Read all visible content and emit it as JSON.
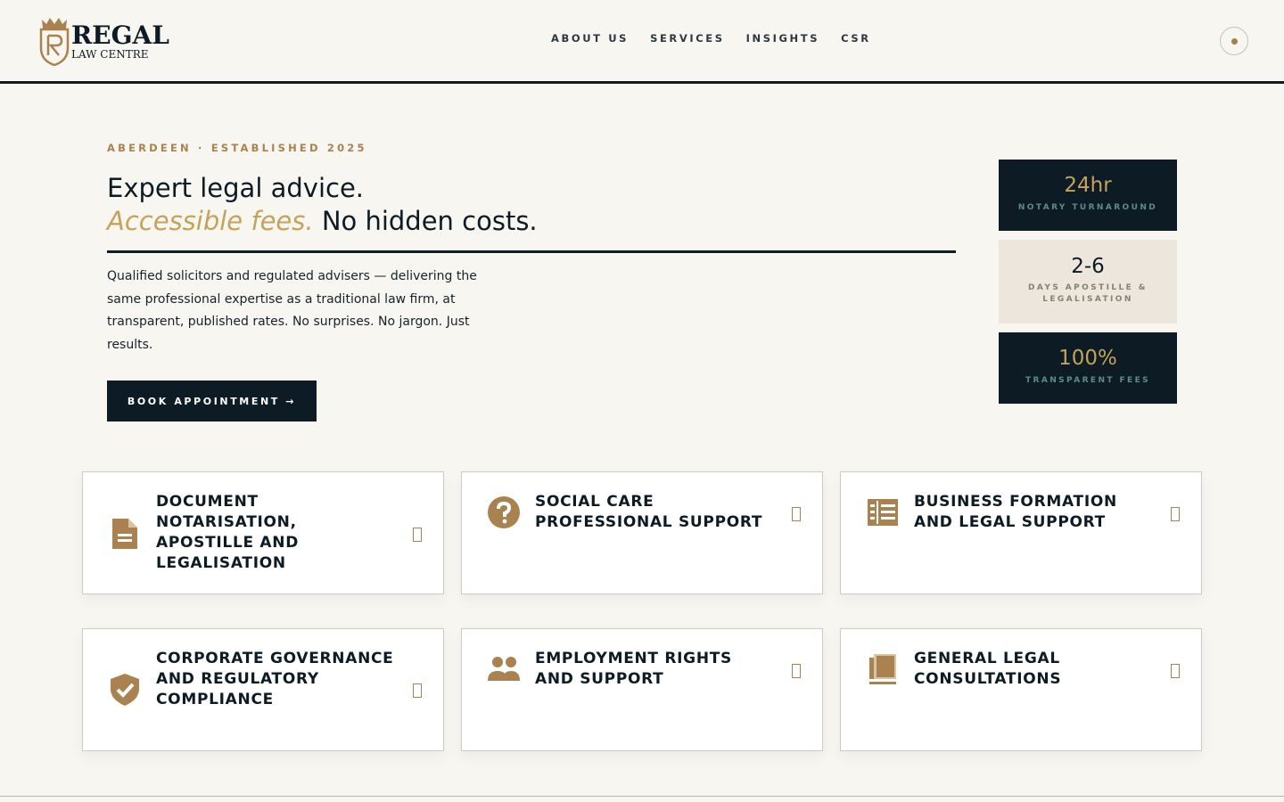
{
  "brand": {
    "name": "REGAL",
    "subtitle": "LAW CENTRE",
    "accent_color": "#c4a35a",
    "dark_color": "#0d1b24"
  },
  "nav": {
    "items": [
      "ABOUT US",
      "SERVICES",
      "INSIGHTS",
      "CSR"
    ]
  },
  "theme_toggle": {
    "icon": "sun-icon"
  },
  "hero": {
    "eyebrow": "ABERDEEN · ESTABLISHED 2025",
    "headline_line1": "Expert legal advice.",
    "headline_accent": "Accessible fees.",
    "headline_rest": "No hidden costs.",
    "intro": "Qualified solicitors and regulated advisers — delivering the same professional expertise as a traditional law firm, at transparent, published rates. No surprises. No jargon. Just results.",
    "cta_label": "BOOK APPOINTMENT →"
  },
  "stats": [
    {
      "value": "24hr",
      "label": "NOTARY TURNAROUND"
    },
    {
      "value": "2-6",
      "label_line1": "DAYS APOSTILLE &",
      "label_line2": "LEGALISATION"
    },
    {
      "value": "100%",
      "label": "TRANSPARENT FEES"
    }
  ],
  "services": [
    {
      "title": "DOCUMENT NOTARISATION, APOSTILLE AND LEGALISATION",
      "icon": "document-icon"
    },
    {
      "title": "SOCIAL CARE PROFESSIONAL SUPPORT",
      "icon": "question-circle-icon"
    },
    {
      "title": "BUSINESS FORMATION AND LEGAL SUPPORT",
      "icon": "list-icon"
    },
    {
      "title": "CORPORATE GOVERNANCE AND REGULATORY COMPLIANCE",
      "icon": "shield-check-icon"
    },
    {
      "title": "EMPLOYMENT RIGHTS AND SUPPORT",
      "icon": "people-icon"
    },
    {
      "title": "GENERAL LEGAL CONSULTATIONS",
      "icon": "book-icon"
    }
  ]
}
